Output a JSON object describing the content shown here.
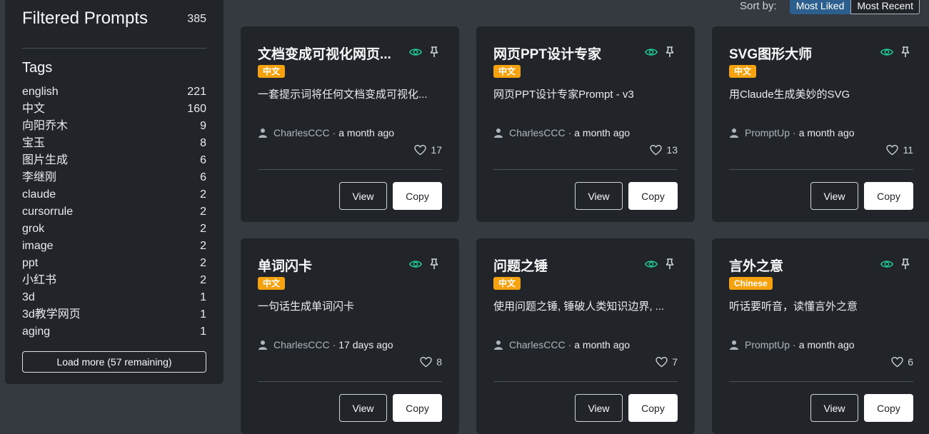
{
  "sidebar": {
    "title": "Filtered Prompts",
    "count": "385",
    "tags_title": "Tags",
    "tags": [
      {
        "name": "english",
        "count": "221"
      },
      {
        "name": "中文",
        "count": "160"
      },
      {
        "name": "向阳乔木",
        "count": "9"
      },
      {
        "name": "宝玉",
        "count": "8"
      },
      {
        "name": "图片生成",
        "count": "6"
      },
      {
        "name": "李继刚",
        "count": "6"
      },
      {
        "name": "claude",
        "count": "2"
      },
      {
        "name": "cursorrule",
        "count": "2"
      },
      {
        "name": "grok",
        "count": "2"
      },
      {
        "name": "image",
        "count": "2"
      },
      {
        "name": "ppt",
        "count": "2"
      },
      {
        "name": "小红书",
        "count": "2"
      },
      {
        "name": "3d",
        "count": "1"
      },
      {
        "name": "3d教学网页",
        "count": "1"
      },
      {
        "name": "aging",
        "count": "1"
      }
    ],
    "load_more": "Load more (57 remaining)"
  },
  "sort": {
    "label": "Sort by:",
    "options": [
      "Most Liked",
      "Most Recent"
    ],
    "selected": "Most Liked"
  },
  "cards": [
    {
      "title": "文档变成可视化网页...",
      "badge": "中文",
      "desc": "一套提示词将任何文档变成可视化...",
      "author": "CharlesCCC",
      "time": "a month ago",
      "likes": "17",
      "view": "View",
      "copy": "Copy"
    },
    {
      "title": "网页PPT设计专家",
      "badge": "中文",
      "desc": "网页PPT设计专家Prompt - v3",
      "author": "CharlesCCC",
      "time": "a month ago",
      "likes": "13",
      "view": "View",
      "copy": "Copy"
    },
    {
      "title": "SVG图形大师",
      "badge": "中文",
      "desc": "用Claude生成美妙的SVG",
      "author": "PromptUp",
      "time": "a month ago",
      "likes": "11",
      "view": "View",
      "copy": "Copy"
    },
    {
      "title": "单词闪卡",
      "badge": "中文",
      "desc": "一句话生成单词闪卡",
      "author": "CharlesCCC",
      "time": "17 days ago",
      "likes": "8",
      "view": "View",
      "copy": "Copy"
    },
    {
      "title": "问题之锤",
      "badge": "中文",
      "desc": "使用问题之锤, 锤破人类知识边界, ...",
      "author": "CharlesCCC",
      "time": "a month ago",
      "likes": "7",
      "view": "View",
      "copy": "Copy"
    },
    {
      "title": "言外之意",
      "badge": "Chinese",
      "desc": "听话要听音，读懂言外之意",
      "author": "PromptUp",
      "time": "a month ago",
      "likes": "6",
      "view": "View",
      "copy": "Copy"
    }
  ],
  "colors": {
    "background": "#343a40",
    "card": "#212529",
    "badge": "#f5a20e",
    "eye_icon": "#20c997",
    "sort_active": "#2c5f8d"
  },
  "icons": {
    "visibility": "eye-icon",
    "pin": "pin-icon",
    "author": "user-icon",
    "likes": "heart-icon"
  }
}
